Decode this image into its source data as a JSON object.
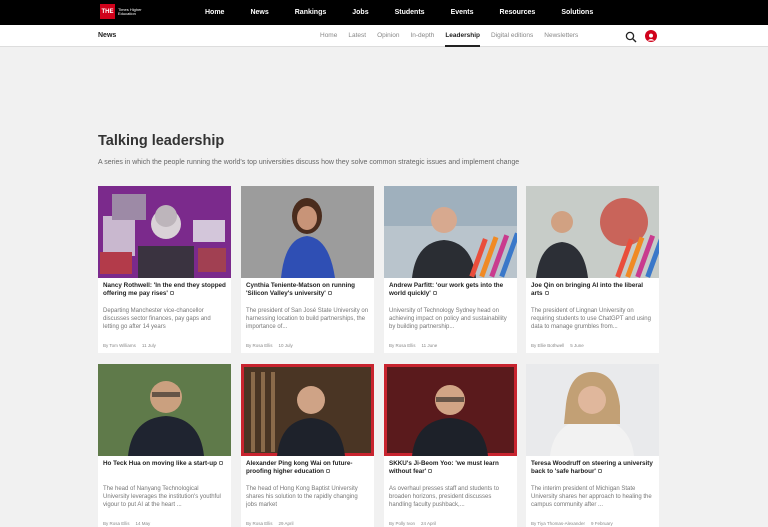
{
  "logo": {
    "mark": "THE",
    "text": "Times Higher Education"
  },
  "topnav": [
    "Home",
    "News",
    "Rankings",
    "Jobs",
    "Students",
    "Events",
    "Resources",
    "Solutions"
  ],
  "section": "News",
  "subnav": [
    "Home",
    "Latest",
    "Opinion",
    "In-depth",
    "Leadership",
    "Digital editions",
    "Newsletters"
  ],
  "page": {
    "title": "Talking leadership",
    "description": "A series in which the people running the world's top universities discuss how they solve common strategic issues and implement change"
  },
  "cards": [
    {
      "title": "Nancy Rothwell: 'In the end they stopped offering me pay rises'",
      "summary": "Departing Manchester vice-chancellor discusses sector finances, pay gaps and letting go after 14 years",
      "author": "By Tom Williams",
      "date": "11 July"
    },
    {
      "title": "Cynthia Teniente-Matson on running 'Silicon Valley's university'",
      "summary": "The president of San José State University on harnessing location to build partnerships, the importance of...",
      "author": "By Rosa Ellis",
      "date": "10 July"
    },
    {
      "title": "Andrew Parfitt: 'our work gets into the world quickly'",
      "summary": "University of Technology Sydney head on achieving impact on policy and sustainability by building partnership...",
      "author": "By Rosa Ellis",
      "date": "11 June"
    },
    {
      "title": "Joe Qin on bringing AI into the liberal arts",
      "summary": "The president of Lingnan University on requiring students to use ChatGPT and using data to manage grumbles from...",
      "author": "By Ellie Bothwell",
      "date": "5 June"
    },
    {
      "title": "Ho Teck Hua on moving like a start-up",
      "summary": "The head of Nanyang Technological University leverages the institution's youthful vigour to put AI at the heart ...",
      "author": "By Rosa Ellis",
      "date": "14 May"
    },
    {
      "title": "Alexander Ping kong Wai on future-proofing higher education",
      "summary": "The head of Hong Kong Baptist University shares his solution to the rapidly changing jobs market",
      "author": "By Rosa Ellis",
      "date": "29 April"
    },
    {
      "title": "SKKU's Ji-Beom Yoo: 'we must learn without fear'",
      "summary": "As overhaul presses staff and students to broaden horizons, president discusses handling faculty pushback,...",
      "author": "By Polly Ivon",
      "date": "24 April"
    },
    {
      "title": "Teresa Woodruff on steering a university back to 'safe harbour'",
      "summary": "The interim president of Michigan State University shares her approach to healing the campus community after ...",
      "author": "By Tiya Thomas-Alexander",
      "date": "9 February"
    }
  ]
}
